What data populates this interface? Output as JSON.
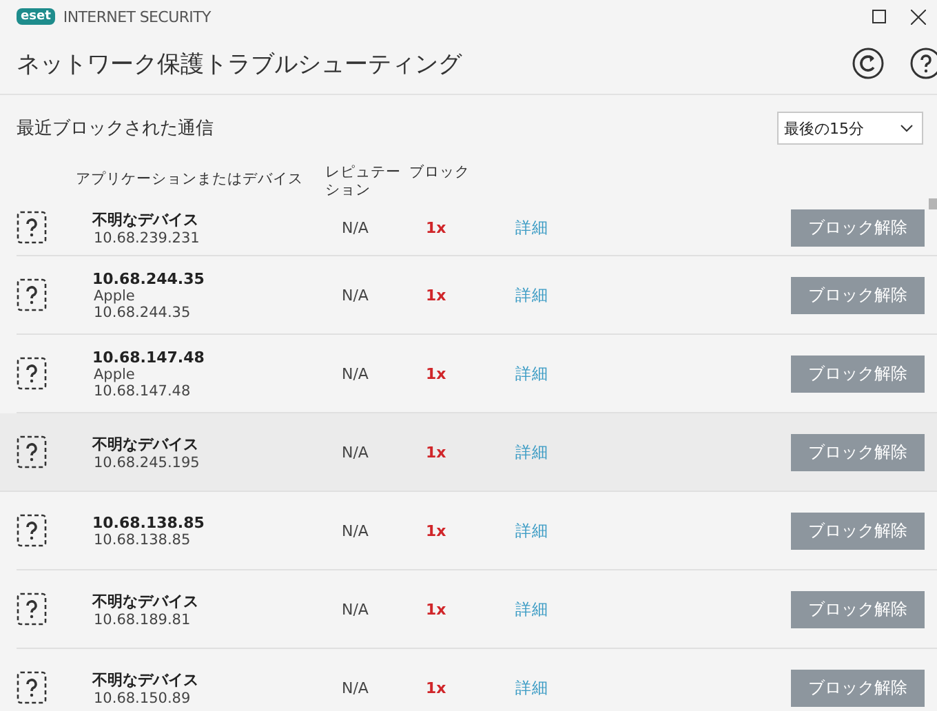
{
  "window": {
    "brand": "eset",
    "title": "INTERNET SECURITY"
  },
  "header": {
    "title": "ネットワーク保護トラブルシューティング"
  },
  "section": {
    "title": "最近ブロックされた通信",
    "period": {
      "value": "最後の15分"
    }
  },
  "table": {
    "columns": [
      "アプリケーションまたはデバイス",
      "レピュテーション",
      "ブロック"
    ],
    "rows": [
      {
        "name": "不明なデバイス",
        "ip": "10.68.239.231",
        "reputation": "N/A",
        "blocks": "1x",
        "details": "詳細",
        "action": "ブロック解除",
        "selected": false
      },
      {
        "name": "10.68.244.35",
        "vendor": "Apple",
        "ip": "10.68.244.35",
        "reputation": "N/A",
        "blocks": "1x",
        "details": "詳細",
        "action": "ブロック解除",
        "selected": false
      },
      {
        "name": "10.68.147.48",
        "vendor": "Apple",
        "ip": "10.68.147.48",
        "reputation": "N/A",
        "blocks": "1x",
        "details": "詳細",
        "action": "ブロック解除",
        "selected": false
      },
      {
        "name": "不明なデバイス",
        "ip": "10.68.245.195",
        "reputation": "N/A",
        "blocks": "1x",
        "details": "詳細",
        "action": "ブロック解除",
        "selected": true
      },
      {
        "name": "10.68.138.85",
        "ip": "10.68.138.85",
        "reputation": "N/A",
        "blocks": "1x",
        "details": "詳細",
        "action": "ブロック解除",
        "selected": false
      },
      {
        "name": "不明なデバイス",
        "ip": "10.68.189.81",
        "reputation": "N/A",
        "blocks": "1x",
        "details": "詳細",
        "action": "ブロック解除",
        "selected": false
      },
      {
        "name": "不明なデバイス",
        "ip": "10.68.150.89",
        "reputation": "N/A",
        "blocks": "1x",
        "details": "詳細",
        "action": "ブロック解除",
        "selected": false
      }
    ]
  }
}
